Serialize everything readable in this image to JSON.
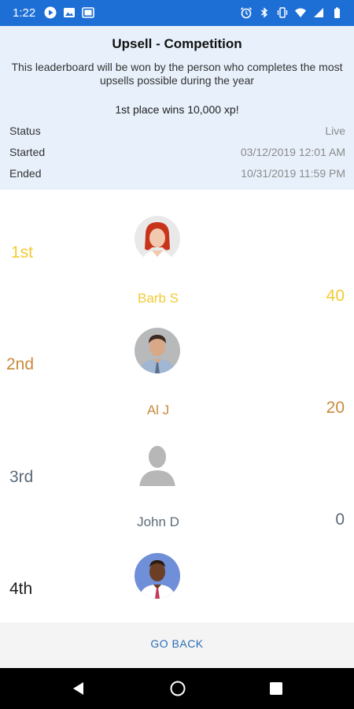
{
  "status_bar": {
    "time": "1:22",
    "left_icons": [
      "play-icon",
      "image-icon",
      "gallery-icon"
    ],
    "right_icons": [
      "alarm-icon",
      "bluetooth-icon",
      "vibrate-icon",
      "wifi-icon",
      "signal-icon",
      "battery-icon"
    ],
    "color": "#1d6fd6"
  },
  "header": {
    "title": "Upsell - Competition",
    "description": "This leaderboard will be won by the person who completes the most upsells possible during the year",
    "prize": "1st place wins 10,000 xp!",
    "status_label": "Status",
    "status_value": "Live",
    "started_label": "Started",
    "started_value": "03/12/2019 12:01 AM",
    "ended_label": "Ended",
    "ended_value": "10/31/2019 11:59 PM"
  },
  "leaderboard": [
    {
      "rank": "1st",
      "name": "Barb S",
      "score": "40",
      "color": "#f3cb33"
    },
    {
      "rank": "2nd",
      "name": "Al J",
      "score": "20",
      "color": "#c98a3b"
    },
    {
      "rank": "3rd",
      "name": "John D",
      "score": "0",
      "color": "#5c6b79"
    },
    {
      "rank": "4th",
      "color": "#1e1e1e"
    }
  ],
  "footer": {
    "go_back_label": "GO BACK"
  },
  "nav_bar": {
    "buttons": [
      "back-icon",
      "home-icon",
      "recents-icon"
    ]
  }
}
